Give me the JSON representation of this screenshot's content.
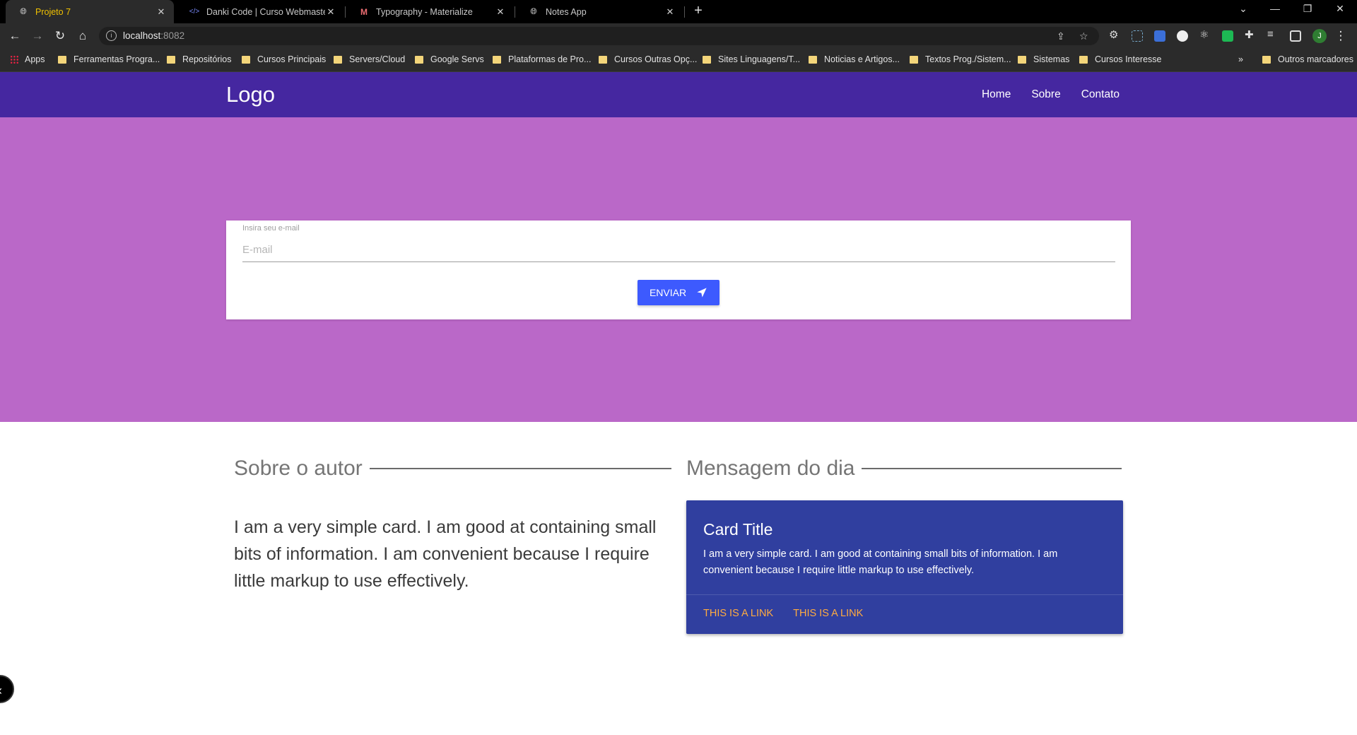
{
  "browser": {
    "tabs": [
      {
        "title": "Projeto 7",
        "icon": "globe-icon"
      },
      {
        "title": "Danki Code | Curso Webmaster F",
        "icon": "code-icon"
      },
      {
        "title": "Typography - Materialize",
        "icon": "materialize-icon"
      },
      {
        "title": "Notes App",
        "icon": "globe-icon"
      }
    ],
    "url_host": "localhost",
    "url_port": ":8082",
    "avatar_initial": "J",
    "bookmarks": [
      "Apps",
      "Ferramentas Progra...",
      "Repositórios",
      "Cursos Principais",
      "Servers/Cloud",
      "Google Servs",
      "Plataformas de Pro...",
      "Cursos Outras Opç...",
      "Sites Linguagens/T...",
      "Noticias e Artigos...",
      "Textos Prog./Sistem...",
      "Sistemas",
      "Cursos Interesse"
    ],
    "bookmarks_overflow": "»",
    "other_bookmarks": "Outros marcadores"
  },
  "site": {
    "logo": "Logo",
    "nav": [
      "Home",
      "Sobre",
      "Contato"
    ],
    "form": {
      "label": "Insira seu e-mail",
      "placeholder": "E-mail",
      "button": "ENVIAR"
    },
    "about": {
      "title": "Sobre o autor",
      "text": "I am a very simple card. I am good at containing small bits of information. I am convenient because I require little markup to use effectively."
    },
    "message": {
      "title": "Mensagem do dia",
      "card_title": "Card Title",
      "card_text": "I am a very simple card. I am good at containing small bits of information. I am convenient because I require little markup to use effectively.",
      "links": [
        "THIS IS A LINK",
        "THIS IS A LINK"
      ]
    }
  },
  "colors": {
    "navbar": "#4527a0",
    "hero": "#ba68c8",
    "button": "#3d5afe",
    "card": "#303f9f",
    "card_link": "#ffab40"
  }
}
